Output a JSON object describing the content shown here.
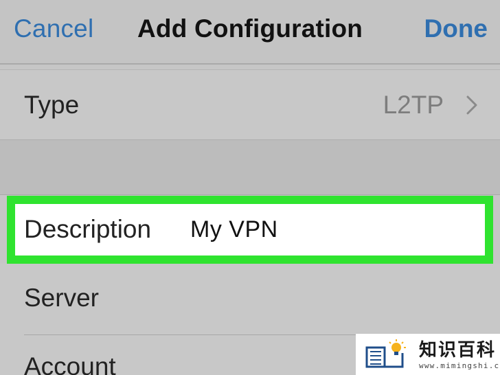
{
  "nav": {
    "cancel_label": "Cancel",
    "title": "Add Configuration",
    "done_label": "Done"
  },
  "type_row": {
    "label": "Type",
    "value": "L2TP"
  },
  "description_row": {
    "label": "Description",
    "value": "My VPN",
    "highlighted": true,
    "highlight_color": "#2fe32f"
  },
  "server_row": {
    "label": "Server"
  },
  "account_row": {
    "label": "Account"
  },
  "watermark": {
    "name": "知识百科",
    "url": "www.mimingshi.com"
  },
  "colors": {
    "accent": "#2f6fb0",
    "background": "#c6c6c6"
  },
  "icons": {
    "chevron": "chevron-right-icon",
    "logo": "book-lightbulb-icon"
  }
}
